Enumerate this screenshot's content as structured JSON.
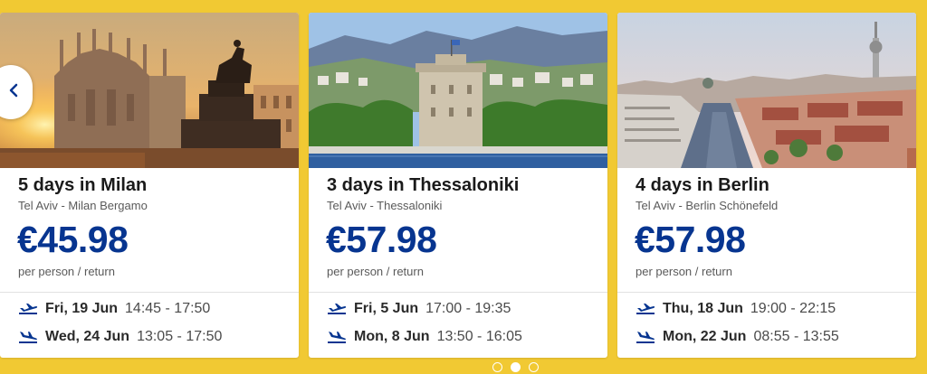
{
  "cards": [
    {
      "title": "5 days in Milan",
      "route": "Tel Aviv - Milan Bergamo",
      "price": "€45.98",
      "per": "per person / return",
      "outbound": {
        "date": "Fri, 19 Jun",
        "time": "14:45 - 17:50"
      },
      "return": {
        "date": "Wed, 24 Jun",
        "time": "13:05 - 17:50"
      }
    },
    {
      "title": "3 days in Thessaloniki",
      "route": "Tel Aviv - Thessaloniki",
      "price": "€57.98",
      "per": "per person / return",
      "outbound": {
        "date": "Fri, 5 Jun",
        "time": "17:00 - 19:35"
      },
      "return": {
        "date": "Mon, 8 Jun",
        "time": "13:50 - 16:05"
      }
    },
    {
      "title": "4 days in Berlin",
      "route": "Tel Aviv - Berlin Schönefeld",
      "price": "€57.98",
      "per": "per person / return",
      "outbound": {
        "date": "Thu, 18 Jun",
        "time": "19:00 - 22:15"
      },
      "return": {
        "date": "Mon, 22 Jun",
        "time": "08:55 - 13:55"
      }
    }
  ],
  "pagination": {
    "count": 3,
    "active_index": 1
  },
  "icons": {
    "prev": "chevron-left-icon",
    "outbound": "plane-takeoff-icon",
    "return": "plane-landing-icon"
  },
  "colors": {
    "background": "#f1c933",
    "price": "#073590",
    "icon": "#073590"
  }
}
